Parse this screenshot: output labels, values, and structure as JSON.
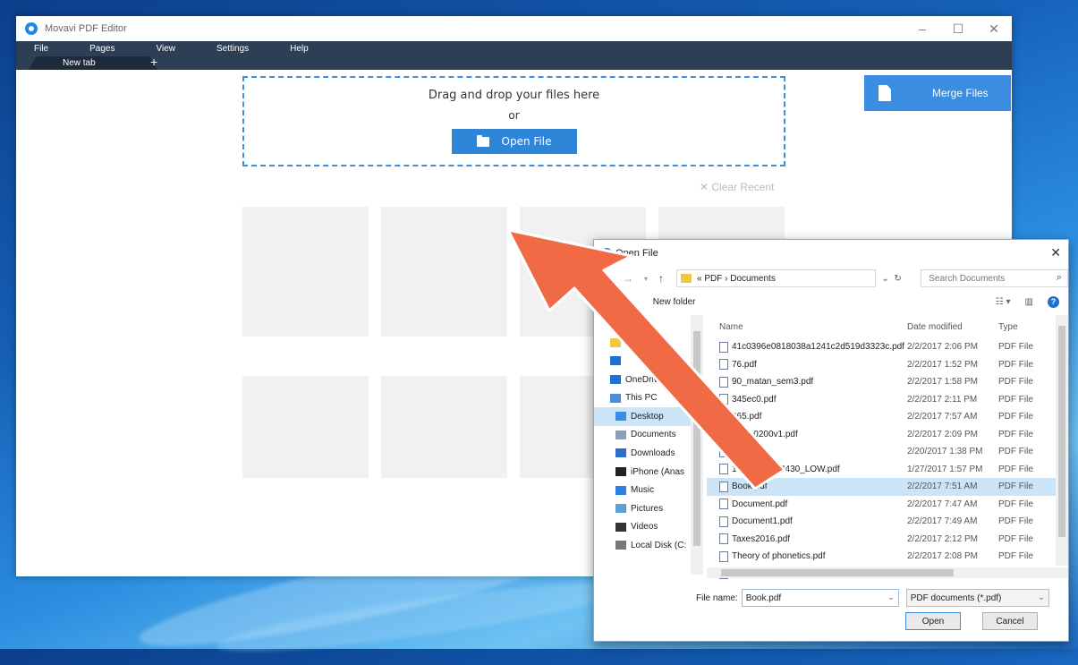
{
  "app": {
    "title": "Movavi PDF Editor",
    "menu": [
      "File",
      "Pages",
      "View",
      "Settings",
      "Help"
    ],
    "tab_label": "New tab",
    "tab_add": "+",
    "drop_text": "Drag and drop your files here",
    "drop_or": "or",
    "open_file_label": "Open File",
    "merge_label": "Merge Files",
    "clear_recent": "✕ Clear Recent",
    "accent_color": "#2f86d8",
    "menubar_color": "#2e3f55"
  },
  "dialog": {
    "title": "Open File",
    "path_prefix": "«",
    "path": [
      "PDF",
      "Documents"
    ],
    "search_placeholder": "Search Documents",
    "organize": "anize ▾",
    "new_folder": "New folder",
    "nav_items": [
      {
        "label": "PDF",
        "icon": "folder-icon"
      },
      {
        "label": "les",
        "icon": "folder-icon"
      },
      {
        "label": "",
        "icon": "dropbox-icon"
      },
      {
        "label": "OneDriv",
        "icon": "onedrive-icon"
      },
      {
        "label": "This PC",
        "icon": "computer-icon"
      },
      {
        "label": "Desktop",
        "icon": "desktop-icon"
      },
      {
        "label": "Documents",
        "icon": "documents-icon"
      },
      {
        "label": "Downloads",
        "icon": "downloads-icon"
      },
      {
        "label": "iPhone (Anas",
        "icon": "phone-icon"
      },
      {
        "label": "Music",
        "icon": "music-icon"
      },
      {
        "label": "Pictures",
        "icon": "pictures-icon"
      },
      {
        "label": "Videos",
        "icon": "videos-icon"
      },
      {
        "label": "Local Disk (C:",
        "icon": "disk-icon"
      }
    ],
    "columns": [
      "Name",
      "Date modified",
      "Type"
    ],
    "files": [
      {
        "name": "41c0396e0818038a1241c2d519d3323c.pdf",
        "date": "2/2/2017 2:06 PM",
        "type": "PDF File"
      },
      {
        "name": "76.pdf",
        "date": "2/2/2017 1:52 PM",
        "type": "PDF File"
      },
      {
        "name": "90_matan_sem3.pdf",
        "date": "2/2/2017 1:58 PM",
        "type": "PDF File"
      },
      {
        "name": "345ec0.pdf",
        "date": "2/2/2017 2:11 PM",
        "type": "PDF File"
      },
      {
        "name": "865.pdf",
        "date": "2/2/2017 7:57 AM",
        "type": "PDF File"
      },
      {
        "name": "1511.0200v1.pdf",
        "date": "2/2/2017 2:09 PM",
        "type": "PDF File"
      },
      {
        "name": "info.pdf",
        "date": "2/20/2017 1:38 PM",
        "type": "PDF File"
      },
      {
        "name": "10 V39_6163430_LOW.pdf",
        "date": "1/27/2017 1:57 PM",
        "type": "PDF File"
      },
      {
        "name": "Book.pdf",
        "date": "2/2/2017 7:51 AM",
        "type": "PDF File"
      },
      {
        "name": "Document.pdf",
        "date": "2/2/2017 7:47 AM",
        "type": "PDF File"
      },
      {
        "name": "Document1.pdf",
        "date": "2/2/2017 7:49 AM",
        "type": "PDF File"
      },
      {
        "name": "Taxes2016.pdf",
        "date": "2/2/2017 2:12 PM",
        "type": "PDF File"
      },
      {
        "name": "Theory of phonetics.pdf",
        "date": "2/2/2017 2:08 PM",
        "type": "PDF File"
      },
      {
        "name": "User manual.pdf",
        "date": "1/27/2017 1:57 PM",
        "type": "PDF File"
      }
    ],
    "selected_index": 8,
    "file_name_label": "File name:",
    "file_name_value": "Book.pdf",
    "file_type": "PDF documents (*.pdf)",
    "open_label": "Open",
    "cancel_label": "Cancel"
  },
  "annotation": {
    "arrow_color": "#ef6a45"
  }
}
